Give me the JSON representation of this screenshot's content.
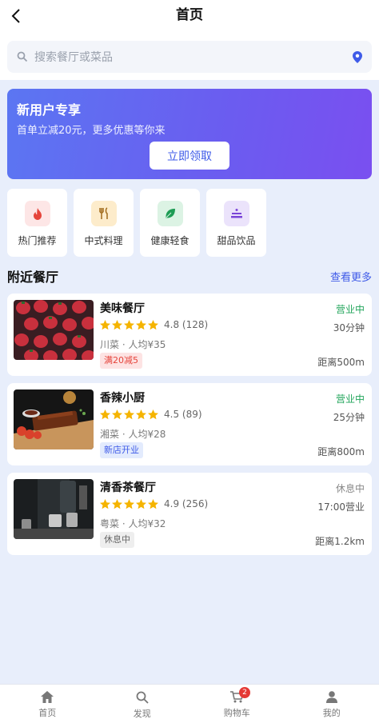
{
  "header": {
    "title": "首页"
  },
  "search": {
    "placeholder": "搜索餐厅或菜品"
  },
  "banner": {
    "title": "新用户专享",
    "subtitle": "首单立减20元，更多优惠等你来",
    "button": "立即领取"
  },
  "categories": [
    {
      "label": "热门推荐",
      "icon": "fire-icon",
      "bg": "#fde6e6",
      "color": "#e5443b"
    },
    {
      "label": "中式料理",
      "icon": "utensils-icon",
      "bg": "#fdeccb",
      "color": "#a06a1a"
    },
    {
      "label": "健康轻食",
      "icon": "leaf-icon",
      "bg": "#dcf3e4",
      "color": "#1e9c55"
    },
    {
      "label": "甜品饮品",
      "icon": "dessert-icon",
      "bg": "#ebe3fb",
      "color": "#7a45d8"
    }
  ],
  "nearby": {
    "title": "附近餐厅",
    "more": "查看更多"
  },
  "restaurants": [
    {
      "name": "美味餐厅",
      "rating": "4.8 (128)",
      "stars": 5,
      "cuisine": "川菜 · 人均¥35",
      "tag": "满20减5",
      "tag_bg": "#fde3e3",
      "tag_color": "#e5443b",
      "status": "营业中",
      "status_color": "#22a55b",
      "time": "30分钟",
      "distance": "距离500m"
    },
    {
      "name": "香辣小厨",
      "rating": "4.5 (89)",
      "stars": 5,
      "cuisine": "湘菜 · 人均¥28",
      "tag": "新店开业",
      "tag_bg": "#e3ebfd",
      "tag_color": "#3f5be8",
      "status": "营业中",
      "status_color": "#22a55b",
      "time": "25分钟",
      "distance": "距离800m"
    },
    {
      "name": "清香茶餐厅",
      "rating": "4.9 (256)",
      "stars": 5,
      "cuisine": "粤菜 · 人均¥32",
      "tag": "休息中",
      "tag_bg": "#eeeeee",
      "tag_color": "#666666",
      "status": "休息中",
      "status_color": "#888888",
      "time": "17:00营业",
      "distance": "距离1.2km"
    }
  ],
  "tabbar": {
    "items": [
      {
        "label": "首页",
        "icon": "home-icon"
      },
      {
        "label": "发现",
        "icon": "search-icon"
      },
      {
        "label": "购物车",
        "icon": "cart-icon",
        "badge": "2"
      },
      {
        "label": "我的",
        "icon": "user-icon"
      }
    ]
  },
  "colors": {
    "accent": "#3f5be8",
    "star": "#f5b400",
    "open": "#22a55b"
  }
}
